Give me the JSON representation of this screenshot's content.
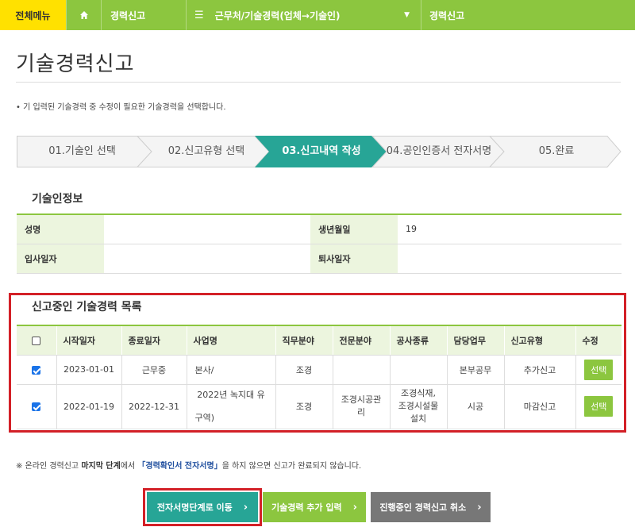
{
  "nav": {
    "all_menu": "전체메뉴",
    "crumb1": "경력신고",
    "crumb2": "근무처/기술경력(업체→기술인)",
    "crumb3": "경력신고"
  },
  "page": {
    "title": "기술경력신고",
    "intro": "• 기 입력된 기술경력 중 수정이 필요한 기술경력을 선택합니다."
  },
  "steps": [
    {
      "label": "01.기술인 선택",
      "active": false
    },
    {
      "label": "02.신고유형 선택",
      "active": false
    },
    {
      "label": "03.신고내역 작성",
      "active": true
    },
    {
      "label": "04.공인인증서 전자서명",
      "active": false
    },
    {
      "label": "05.완료",
      "active": false
    }
  ],
  "colors": {
    "accent_green": "#8cc63f",
    "teal": "#27a596",
    "highlight_red": "#d32027",
    "yellow": "#ffe100"
  },
  "engineer_info": {
    "title": "기술인정보",
    "name_label": "성명",
    "name_value": "",
    "birth_label": "생년월일",
    "birth_value": "19",
    "join_label": "입사일자",
    "join_value": "",
    "leave_label": "퇴사일자",
    "leave_value": ""
  },
  "career_list": {
    "title": "신고중인 기술경력 목록",
    "headers": [
      "시작일자",
      "종료일자",
      "사업명",
      "직무분야",
      "전문분야",
      "공사종류",
      "담당업무",
      "신고유형",
      "수정"
    ],
    "rows": [
      {
        "checked": true,
        "start": "2023-01-01",
        "end": "근무중",
        "project_line1": "본사/",
        "project_line2": "",
        "job_field": "조경",
        "specialty_line1": "",
        "specialty_line2": "",
        "work_type_line1": "",
        "work_type_line2": "",
        "work_type_line3": "",
        "duty": "본부공무",
        "report_type": "추가신고",
        "action": "선택"
      },
      {
        "checked": true,
        "start": "2022-01-19",
        "end": "2022-12-31",
        "project_line1": "2022년 녹지대 유",
        "project_line2": "구역)",
        "job_field": "조경",
        "specialty_line1": "조경시공관",
        "specialty_line2": "리",
        "work_type_line1": "조경식재,",
        "work_type_line2": "조경시설물",
        "work_type_line3": "설치",
        "duty": "시공",
        "report_type": "마감신고",
        "action": "선택"
      }
    ]
  },
  "note": {
    "prefix": "※ 온라인 경력신고 ",
    "bold": "마지막 단계",
    "mid": "에서 ",
    "highlight": "「경력확인서 전자서명」",
    "suffix": "을 하지 않으면 신고가 완료되지 않습니다."
  },
  "buttons": {
    "sign": "전자서명단계로 이동",
    "add": "기술경력 추가 입력",
    "cancel": "진행중인 경력신고 취소"
  },
  "icons": {
    "home": "home-icon",
    "menu": "hamburger-icon",
    "dropdown": "caret-down-icon",
    "chevron": "chevron-right-icon"
  }
}
